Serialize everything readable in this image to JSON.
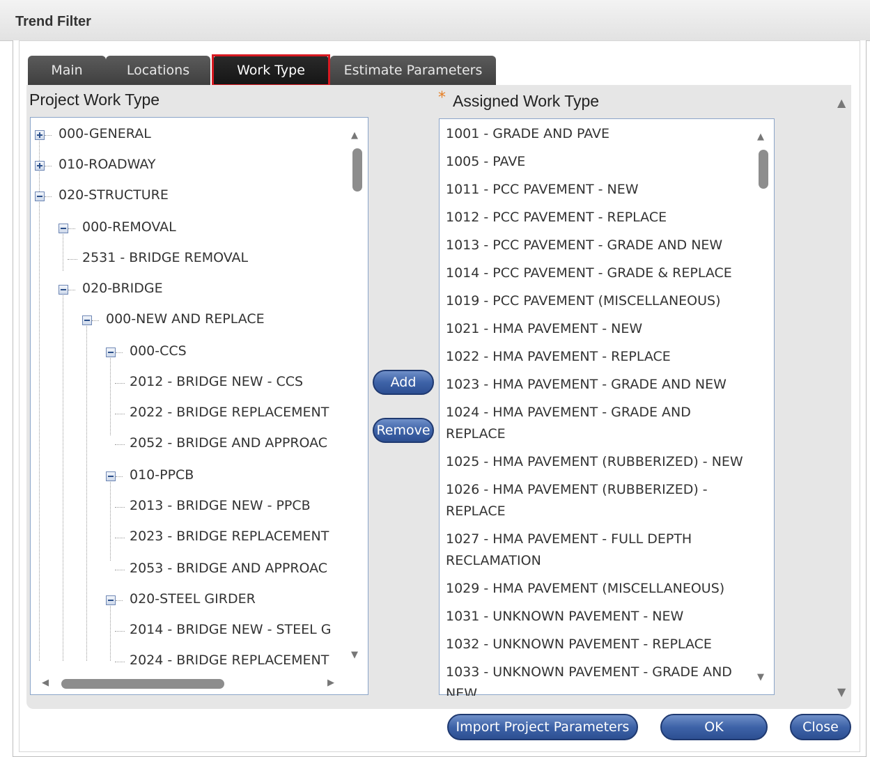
{
  "dialog": {
    "title": "Trend Filter"
  },
  "tabs": [
    {
      "label": "Main"
    },
    {
      "label": "Locations"
    },
    {
      "label": "Work Type"
    },
    {
      "label": "Estimate Parameters"
    }
  ],
  "active_tab": "Work Type",
  "left_panel": {
    "title": "Project Work Type",
    "tree": [
      {
        "label": "000-GENERAL",
        "level": 0,
        "state": "collapsed"
      },
      {
        "label": "010-ROADWAY",
        "level": 0,
        "state": "collapsed"
      },
      {
        "label": "020-STRUCTURE",
        "level": 0,
        "state": "expanded"
      },
      {
        "label": "000-REMOVAL",
        "level": 1,
        "state": "expanded"
      },
      {
        "label": "2531 - BRIDGE REMOVAL",
        "level": 2,
        "state": "leaf"
      },
      {
        "label": "020-BRIDGE",
        "level": 1,
        "state": "expanded"
      },
      {
        "label": "000-NEW AND REPLACE",
        "level": 2,
        "state": "expanded"
      },
      {
        "label": "000-CCS",
        "level": 3,
        "state": "expanded"
      },
      {
        "label": "2012 - BRIDGE NEW - CCS",
        "level": 4,
        "state": "leaf"
      },
      {
        "label": "2022 - BRIDGE REPLACEMENT",
        "level": 4,
        "state": "leaf"
      },
      {
        "label": "2052 - BRIDGE AND APPROAC",
        "level": 4,
        "state": "leaf"
      },
      {
        "label": "010-PPCB",
        "level": 3,
        "state": "expanded"
      },
      {
        "label": "2013 - BRIDGE NEW - PPCB",
        "level": 4,
        "state": "leaf"
      },
      {
        "label": "2023 - BRIDGE REPLACEMENT",
        "level": 4,
        "state": "leaf"
      },
      {
        "label": "2053 - BRIDGE AND APPROAC",
        "level": 4,
        "state": "leaf"
      },
      {
        "label": "020-STEEL GIRDER",
        "level": 3,
        "state": "expanded"
      },
      {
        "label": "2014 - BRIDGE NEW - STEEL G",
        "level": 4,
        "state": "leaf"
      },
      {
        "label": "2024 - BRIDGE REPLACEMENT",
        "level": 4,
        "state": "leaf"
      }
    ]
  },
  "buttons": {
    "add": "Add",
    "remove": "Remove",
    "import": "Import Project Parameters",
    "ok": "OK",
    "close": "Close"
  },
  "right_panel": {
    "title": "Assigned Work Type",
    "required_marker": "*",
    "items": [
      [
        "1001 - GRADE AND PAVE"
      ],
      [
        "1005 - PAVE"
      ],
      [
        "1011 - PCC PAVEMENT - NEW"
      ],
      [
        "1012 - PCC PAVEMENT - REPLACE"
      ],
      [
        "1013 - PCC PAVEMENT - GRADE AND NEW"
      ],
      [
        "1014 - PCC PAVEMENT - GRADE & REPLACE"
      ],
      [
        "1019 - PCC PAVEMENT (MISCELLANEOUS)"
      ],
      [
        "1021 - HMA PAVEMENT - NEW"
      ],
      [
        "1022 - HMA PAVEMENT - REPLACE"
      ],
      [
        "1023 - HMA PAVEMENT - GRADE AND NEW"
      ],
      [
        "1024 - HMA PAVEMENT - GRADE AND",
        "REPLACE"
      ],
      [
        "1025 - HMA PAVEMENT (RUBBERIZED) - NEW"
      ],
      [
        "1026 - HMA PAVEMENT (RUBBERIZED) -",
        "REPLACE"
      ],
      [
        "1027 - HMA PAVEMENT - FULL DEPTH",
        "RECLAMATION"
      ],
      [
        "1029 - HMA PAVEMENT (MISCELLANEOUS)"
      ],
      [
        "1031 - UNKNOWN PAVEMENT - NEW"
      ],
      [
        "1032 - UNKNOWN PAVEMENT - REPLACE"
      ],
      [
        "1033 - UNKNOWN PAVEMENT - GRADE AND",
        "NEW"
      ]
    ]
  },
  "icons": {
    "expand": "plus-box-icon",
    "collapse": "minus-box-icon",
    "scroll_up": "triangle-up-icon",
    "scroll_down": "triangle-down-icon",
    "scroll_left": "triangle-left-icon",
    "scroll_right": "triangle-right-icon"
  },
  "colors": {
    "button_blue": "#3e63a8",
    "tab_dark": "#3f3f3f",
    "highlight_red": "#d71921",
    "required_orange": "#e67e22",
    "list_border": "#8aa4c8"
  }
}
